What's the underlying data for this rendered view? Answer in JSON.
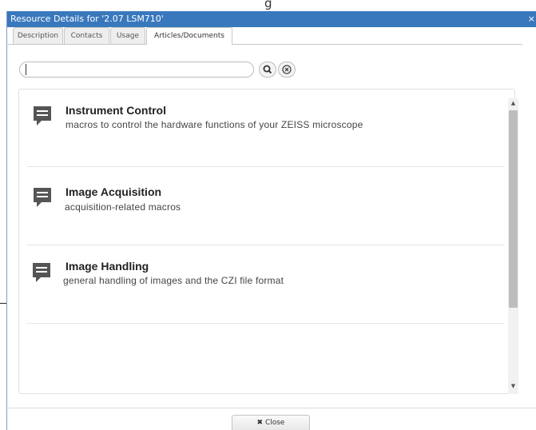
{
  "dialog": {
    "title": "Resource Details for '2.07 LSM710'",
    "close_glyph": "×"
  },
  "stray_top_text": "g",
  "tabs": [
    {
      "label": "Description",
      "active": false
    },
    {
      "label": "Contacts",
      "active": false
    },
    {
      "label": "Usage",
      "active": false
    },
    {
      "label": "Articles/Documents",
      "active": true
    }
  ],
  "search": {
    "value": "",
    "placeholder": "",
    "search_icon": "magnifier-icon",
    "clear_icon": "circle-x-icon"
  },
  "items": [
    {
      "title": "Instrument Control",
      "description": "macros to control the hardware functions of your ZEISS microscope",
      "icon": "comment-icon"
    },
    {
      "title": "Image Acquisition",
      "description": "acquisition-related macros",
      "icon": "comment-icon"
    },
    {
      "title": "Image Handling",
      "description": "general handling of images and the CZI file format",
      "icon": "comment-icon"
    }
  ],
  "footer": {
    "close_label": "Close",
    "close_icon": "x-icon"
  },
  "colors": {
    "titlebar": "#3a78bd",
    "icon": "#555555"
  }
}
